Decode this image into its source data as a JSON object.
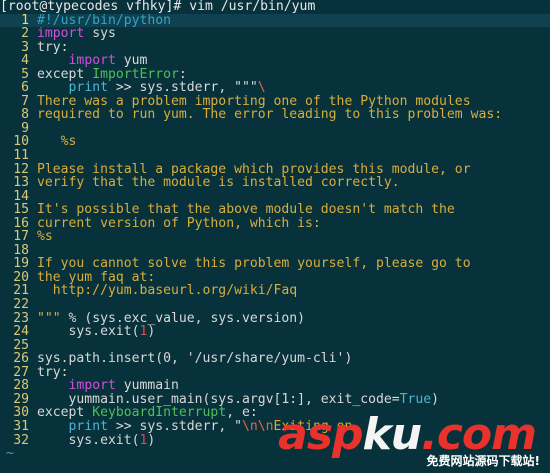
{
  "terminal": {
    "prompt": "[root@typecodes vfhky]# vim /usr/bin/yum",
    "current_line": 1,
    "empty_line_marker": "~"
  },
  "lines": [
    [
      {
        "t": "#!/usr/bin/python",
        "c": "comment"
      }
    ],
    [
      {
        "t": "import",
        "c": "kw"
      },
      {
        "t": " sys",
        "c": "plain"
      }
    ],
    [
      {
        "t": "try:",
        "c": "plain"
      }
    ],
    [
      {
        "t": "    ",
        "c": "plain"
      },
      {
        "t": "import",
        "c": "kw"
      },
      {
        "t": " yum",
        "c": "plain"
      }
    ],
    [
      {
        "t": "except ",
        "c": "plain"
      },
      {
        "t": "ImportError",
        "c": "exc"
      },
      {
        "t": ":",
        "c": "plain"
      }
    ],
    [
      {
        "t": "    ",
        "c": "plain"
      },
      {
        "t": "print",
        "c": "builtin"
      },
      {
        "t": " >> sys.stderr, \"\"\"",
        "c": "plain"
      },
      {
        "t": "\\",
        "c": "special"
      }
    ],
    [
      {
        "t": "There was a problem importing one of the Python modules",
        "c": "str"
      }
    ],
    [
      {
        "t": "required to run yum. The error leading to this problem was:",
        "c": "str"
      }
    ],
    [
      {
        "t": "",
        "c": "str"
      }
    ],
    [
      {
        "t": "   %s",
        "c": "str"
      }
    ],
    [
      {
        "t": "",
        "c": "str"
      }
    ],
    [
      {
        "t": "Please install a package which provides this module, or",
        "c": "str"
      }
    ],
    [
      {
        "t": "verify that the module is installed correctly.",
        "c": "str"
      }
    ],
    [
      {
        "t": "",
        "c": "str"
      }
    ],
    [
      {
        "t": "It's possible that the above module doesn't match the",
        "c": "str"
      }
    ],
    [
      {
        "t": "current version of Python, which is:",
        "c": "str"
      }
    ],
    [
      {
        "t": "%s",
        "c": "str"
      }
    ],
    [
      {
        "t": "",
        "c": "str"
      }
    ],
    [
      {
        "t": "If you cannot solve this problem yourself, please go to",
        "c": "str"
      }
    ],
    [
      {
        "t": "the yum faq at:",
        "c": "str"
      }
    ],
    [
      {
        "t": "  http://yum.baseurl.org/wiki/Faq",
        "c": "str"
      }
    ],
    [
      {
        "t": "",
        "c": "str"
      }
    ],
    [
      {
        "t": "\"\"\" ",
        "c": "str"
      },
      {
        "t": "% (sys.exc_value, sys.version)",
        "c": "plain"
      }
    ],
    [
      {
        "t": "    sys.exit(",
        "c": "plain"
      },
      {
        "t": "1",
        "c": "const"
      },
      {
        "t": ")",
        "c": "plain"
      }
    ],
    [
      {
        "t": "",
        "c": "plain"
      }
    ],
    [
      {
        "t": "sys.path.insert(0, '/usr/share/yum-cli')",
        "c": "plain"
      }
    ],
    [
      {
        "t": "try:",
        "c": "plain"
      }
    ],
    [
      {
        "t": "    ",
        "c": "plain"
      },
      {
        "t": "import",
        "c": "kw"
      },
      {
        "t": " yummain",
        "c": "plain"
      }
    ],
    [
      {
        "t": "    yummain.user_main(sys.argv[1:], exit_code=",
        "c": "plain"
      },
      {
        "t": "True",
        "c": "builtin"
      },
      {
        "t": ")",
        "c": "plain"
      }
    ],
    [
      {
        "t": "except ",
        "c": "plain"
      },
      {
        "t": "KeyboardInterrupt",
        "c": "exc"
      },
      {
        "t": ", e:",
        "c": "plain"
      }
    ],
    [
      {
        "t": "    ",
        "c": "plain"
      },
      {
        "t": "print",
        "c": "builtin"
      },
      {
        "t": " >> sys.stderr, \"",
        "c": "plain"
      },
      {
        "t": "\\n\\n",
        "c": "special"
      },
      {
        "t": "Exiting on ",
        "c": "str"
      }
    ],
    [
      {
        "t": "    sys.exit(",
        "c": "plain"
      },
      {
        "t": "1",
        "c": "const"
      },
      {
        "t": ")",
        "c": "plain"
      }
    ]
  ],
  "watermark": {
    "logo_red_1": "asp",
    "logo_white": "ku",
    "logo_red_2": ".com",
    "subtitle": "免费网站源码下载站!"
  }
}
